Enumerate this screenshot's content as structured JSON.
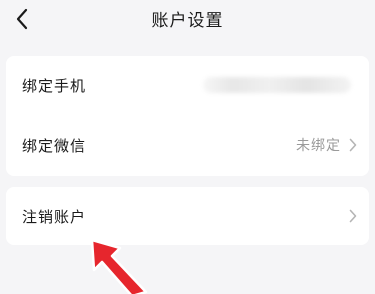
{
  "header": {
    "title": "账户设置",
    "back_icon": "chevron-left-icon"
  },
  "account": {
    "phone": {
      "label": "绑定手机",
      "value_obscured": true
    },
    "wechat": {
      "label": "绑定微信",
      "value": "未绑定"
    }
  },
  "danger": {
    "cancel_account": {
      "label": "注销账户"
    }
  },
  "overlay": {
    "pointer_icon": "red-arrow-icon",
    "pointer_color": "#e6262d"
  },
  "colors": {
    "background": "#f5f5f7",
    "card": "#ffffff",
    "muted_text": "#9a9a9a"
  }
}
